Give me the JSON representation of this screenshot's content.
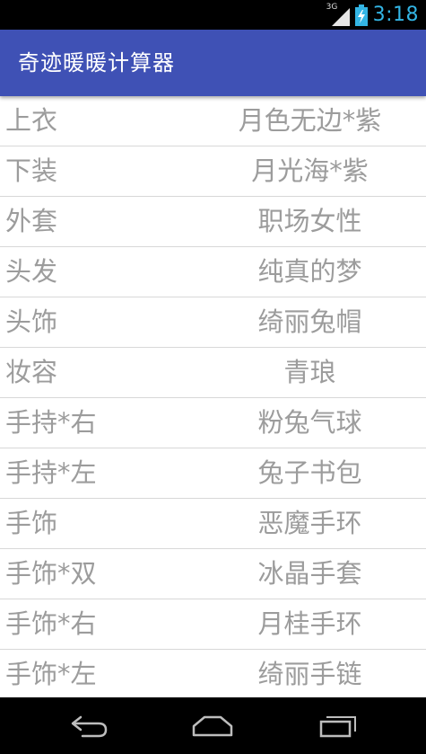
{
  "status_bar": {
    "network_label": "3G",
    "time": "3:18",
    "accent_color": "#33b5e5"
  },
  "app_bar": {
    "title": "奇迹暖暖计算器",
    "color": "#3f51b5"
  },
  "outfit": [
    {
      "slot": "上衣",
      "item": "月色无边*紫"
    },
    {
      "slot": "下装",
      "item": "月光海*紫"
    },
    {
      "slot": "外套",
      "item": "职场女性"
    },
    {
      "slot": "头发",
      "item": "纯真的梦"
    },
    {
      "slot": "头饰",
      "item": "绮丽兔帽"
    },
    {
      "slot": "妆容",
      "item": "青琅"
    },
    {
      "slot": "手持*右",
      "item": "粉兔气球"
    },
    {
      "slot": "手持*左",
      "item": "兔子书包"
    },
    {
      "slot": "手饰",
      "item": "恶魔手环"
    },
    {
      "slot": "手饰*双",
      "item": "冰晶手套"
    },
    {
      "slot": "手饰*右",
      "item": "月桂手环"
    },
    {
      "slot": "手饰*左",
      "item": "绮丽手链"
    }
  ],
  "nav_bar": {
    "back": "back-icon",
    "home": "home-icon",
    "recents": "recents-icon"
  }
}
